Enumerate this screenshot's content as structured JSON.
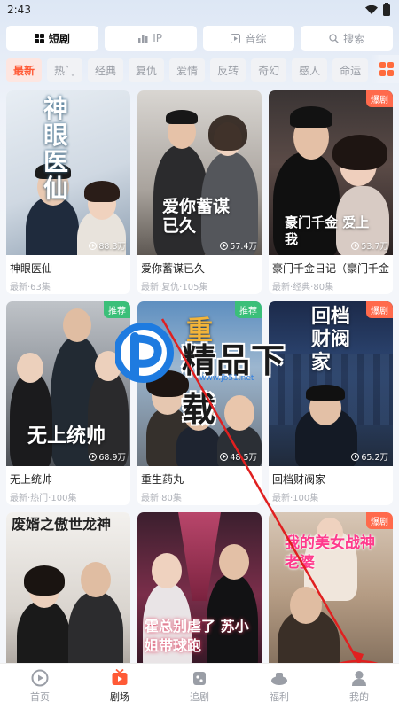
{
  "status": {
    "time": "2:43"
  },
  "top_tabs": [
    {
      "label": "短剧",
      "icon": "grid-icon",
      "active": true
    },
    {
      "label": "IP",
      "icon": "bar-chart-icon",
      "active": false
    },
    {
      "label": "音综",
      "icon": "play-square-icon",
      "active": false
    },
    {
      "label": "搜索",
      "icon": "search-icon",
      "active": false
    }
  ],
  "categories": [
    "最新",
    "热门",
    "经典",
    "复仇",
    "爱情",
    "反转",
    "奇幻",
    "感人",
    "命运"
  ],
  "cards": [
    {
      "title": "神眼医仙",
      "meta": "最新·63集",
      "plays": "88.3万",
      "badge": "",
      "art": "神眼医仙"
    },
    {
      "title": "爱你蓄谋已久",
      "meta": "最新·复仇·105集",
      "plays": "57.4万",
      "badge": "",
      "art": "爱你蓄谋已久"
    },
    {
      "title": "豪门千金日记（豪门千金",
      "meta": "最新·经典·80集",
      "plays": "53.7万",
      "badge": "爆剧",
      "art": "豪门千金 爱上我"
    },
    {
      "title": "无上统帅",
      "meta": "最新·热门·100集",
      "plays": "68.9万",
      "badge": "推荐",
      "art": "无上统帅"
    },
    {
      "title": "重生药丸",
      "meta": "最新·80集",
      "plays": "48.5万",
      "badge": "推荐",
      "art": "重"
    },
    {
      "title": "回档财阀家",
      "meta": "最新·100集",
      "plays": "65.2万",
      "badge": "爆剧",
      "art": "回档财阀家"
    },
    {
      "title": "",
      "meta": "",
      "plays": "",
      "badge": "",
      "art": "废婿之傲世龙神"
    },
    {
      "title": "",
      "meta": "",
      "plays": "",
      "badge": "",
      "art": "霍总别虐了 苏小姐带球跑"
    },
    {
      "title": "",
      "meta": "",
      "plays": "",
      "badge": "爆剧",
      "art": "我的美女战神老婆"
    }
  ],
  "watermark": {
    "text": "精品下载",
    "sub": "www.jb51.net"
  },
  "bottom_nav": [
    {
      "label": "首页",
      "icon": "home-icon",
      "active": false
    },
    {
      "label": "剧场",
      "icon": "theater-icon",
      "active": true
    },
    {
      "label": "追剧",
      "icon": "follow-icon",
      "active": false
    },
    {
      "label": "福利",
      "icon": "gift-icon",
      "active": false
    },
    {
      "label": "我的",
      "icon": "profile-icon",
      "active": false
    }
  ],
  "colors": {
    "accent": "#ff5a36",
    "hot_badge": "#ff6a4c",
    "rec_badge": "#3bbf79",
    "annotation": "#e02020"
  }
}
